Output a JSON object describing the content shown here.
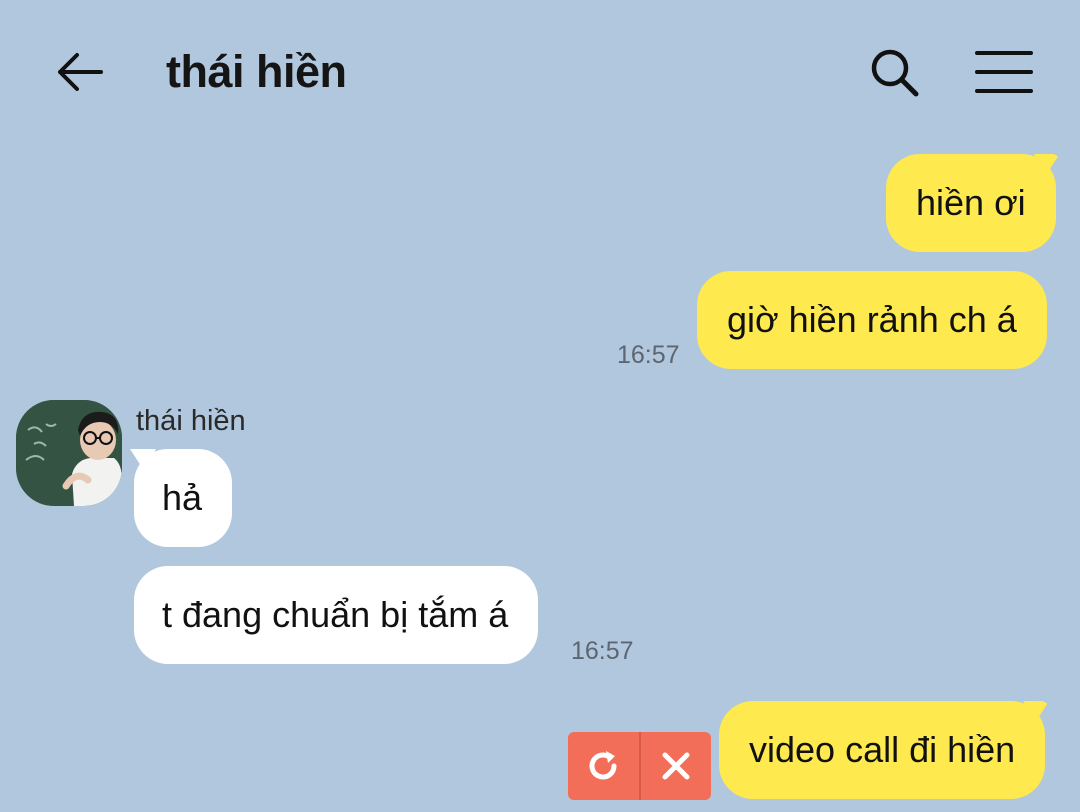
{
  "header": {
    "title": "thái hiền",
    "back_icon": "arrow-left-icon",
    "search_icon": "search-icon",
    "menu_icon": "hamburger-menu-icon"
  },
  "messages": [
    {
      "from": "me",
      "text": "hiền ơi"
    },
    {
      "from": "me",
      "text": "giờ hiền rảnh ch á",
      "time": "16:57"
    },
    {
      "from": "them",
      "sender": "thái hiền",
      "text": "hả"
    },
    {
      "from": "them",
      "text": "t đang chuẩn bị tắm á",
      "time": "16:57"
    },
    {
      "from": "me",
      "text": "video call đi hiền",
      "status": "failed"
    }
  ],
  "failed_actions": {
    "retry_icon": "retry-icon",
    "delete_icon": "close-icon"
  },
  "colors": {
    "background": "#b1c7dd",
    "my_bubble": "#fee94e",
    "their_bubble": "#ffffff",
    "failed_actions": "#f36e58"
  }
}
